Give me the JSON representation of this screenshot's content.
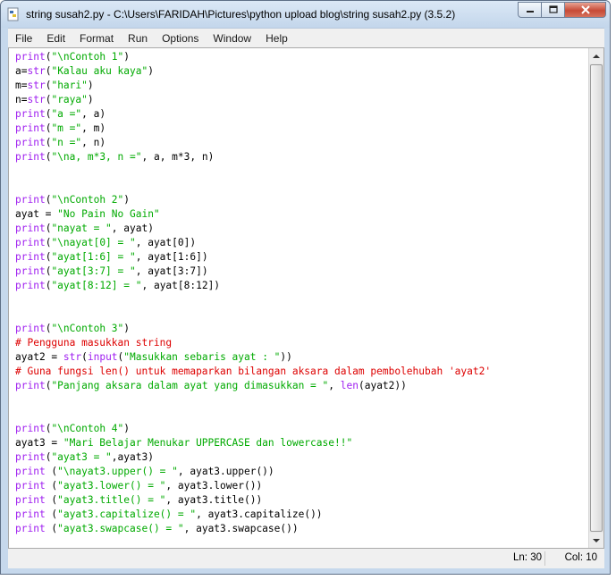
{
  "window": {
    "title": "string susah2.py - C:\\Users\\FARIDAH\\Pictures\\python upload blog\\string susah2.py (3.5.2)"
  },
  "menu": [
    "File",
    "Edit",
    "Format",
    "Run",
    "Options",
    "Window",
    "Help"
  ],
  "code_lines": [
    [
      [
        "kw",
        "print"
      ],
      [
        "",
        "("
      ],
      [
        "str",
        "\"\\nContoh 1\""
      ],
      [
        "",
        ")"
      ]
    ],
    [
      [
        "",
        "a="
      ],
      [
        "kw",
        "str"
      ],
      [
        "",
        "("
      ],
      [
        "str",
        "\"Kalau aku kaya\""
      ],
      [
        "",
        ")"
      ]
    ],
    [
      [
        "",
        "m="
      ],
      [
        "kw",
        "str"
      ],
      [
        "",
        "("
      ],
      [
        "str",
        "\"hari\""
      ],
      [
        "",
        ")"
      ]
    ],
    [
      [
        "",
        "n="
      ],
      [
        "kw",
        "str"
      ],
      [
        "",
        "("
      ],
      [
        "str",
        "\"raya\""
      ],
      [
        "",
        ")"
      ]
    ],
    [
      [
        "kw",
        "print"
      ],
      [
        "",
        "("
      ],
      [
        "str",
        "\"a =\""
      ],
      [
        "",
        ", a)"
      ]
    ],
    [
      [
        "kw",
        "print"
      ],
      [
        "",
        "("
      ],
      [
        "str",
        "\"m =\""
      ],
      [
        "",
        ", m)"
      ]
    ],
    [
      [
        "kw",
        "print"
      ],
      [
        "",
        "("
      ],
      [
        "str",
        "\"n =\""
      ],
      [
        "",
        ", n)"
      ]
    ],
    [
      [
        "kw",
        "print"
      ],
      [
        "",
        "("
      ],
      [
        "str",
        "\"\\na, m*3, n =\""
      ],
      [
        "",
        ", a, m*3, n)"
      ]
    ],
    [],
    [],
    [
      [
        "kw",
        "print"
      ],
      [
        "",
        "("
      ],
      [
        "str",
        "\"\\nContoh 2\""
      ],
      [
        "",
        ")"
      ]
    ],
    [
      [
        "",
        "ayat = "
      ],
      [
        "str",
        "\"No Pain No Gain\""
      ]
    ],
    [
      [
        "kw",
        "print"
      ],
      [
        "",
        "("
      ],
      [
        "str",
        "\"nayat = \""
      ],
      [
        "",
        ", ayat)"
      ]
    ],
    [
      [
        "kw",
        "print"
      ],
      [
        "",
        "("
      ],
      [
        "str",
        "\"\\nayat[0] = \""
      ],
      [
        "",
        ", ayat[0])"
      ]
    ],
    [
      [
        "kw",
        "print"
      ],
      [
        "",
        "("
      ],
      [
        "str",
        "\"ayat[1:6] = \""
      ],
      [
        "",
        ", ayat[1:6])"
      ]
    ],
    [
      [
        "kw",
        "print"
      ],
      [
        "",
        "("
      ],
      [
        "str",
        "\"ayat[3:7] = \""
      ],
      [
        "",
        ", ayat[3:7])"
      ]
    ],
    [
      [
        "kw",
        "print"
      ],
      [
        "",
        "("
      ],
      [
        "str",
        "\"ayat[8:12] = \""
      ],
      [
        "",
        ", ayat[8:12])"
      ]
    ],
    [],
    [],
    [
      [
        "kw",
        "print"
      ],
      [
        "",
        "("
      ],
      [
        "str",
        "\"\\nContoh 3\""
      ],
      [
        "",
        ")"
      ]
    ],
    [
      [
        "cm",
        "# Pengguna masukkan string"
      ]
    ],
    [
      [
        "",
        "ayat2 = "
      ],
      [
        "kw",
        "str"
      ],
      [
        "",
        "("
      ],
      [
        "kw",
        "input"
      ],
      [
        "",
        "("
      ],
      [
        "str",
        "\"Masukkan sebaris ayat : \""
      ],
      [
        "",
        "))"
      ]
    ],
    [
      [
        "cm",
        "# Guna fungsi len() untuk memaparkan bilangan aksara dalam pembolehubah 'ayat2'"
      ]
    ],
    [
      [
        "kw",
        "print"
      ],
      [
        "",
        "("
      ],
      [
        "str",
        "\"Panjang aksara dalam ayat yang dimasukkan = \""
      ],
      [
        "",
        ", "
      ],
      [
        "kw",
        "len"
      ],
      [
        "",
        "(ayat2))"
      ]
    ],
    [],
    [],
    [
      [
        "kw",
        "print"
      ],
      [
        "",
        "("
      ],
      [
        "str",
        "\"\\nContoh 4\""
      ],
      [
        "",
        ")"
      ]
    ],
    [
      [
        "",
        "ayat3 = "
      ],
      [
        "str",
        "\"Mari Belajar Menukar UPPERCASE dan lowercase!!\""
      ]
    ],
    [
      [
        "kw",
        "print"
      ],
      [
        "",
        "("
      ],
      [
        "str",
        "\"ayat3 = \""
      ],
      [
        "",
        ",ayat3)"
      ]
    ],
    [
      [
        "kw",
        "print"
      ],
      [
        "",
        " ("
      ],
      [
        "str",
        "\"\\nayat3.upper() = \""
      ],
      [
        "",
        ", ayat3.upper())"
      ]
    ],
    [
      [
        "kw",
        "print"
      ],
      [
        "",
        " ("
      ],
      [
        "str",
        "\"ayat3.lower() = \""
      ],
      [
        "",
        ", ayat3.lower())"
      ]
    ],
    [
      [
        "kw",
        "print"
      ],
      [
        "",
        " ("
      ],
      [
        "str",
        "\"ayat3.title() = \""
      ],
      [
        "",
        ", ayat3.title())"
      ]
    ],
    [
      [
        "kw",
        "print"
      ],
      [
        "",
        " ("
      ],
      [
        "str",
        "\"ayat3.capitalize() = \""
      ],
      [
        "",
        ", ayat3.capitalize())"
      ]
    ],
    [
      [
        "kw",
        "print"
      ],
      [
        "",
        " ("
      ],
      [
        "str",
        "\"ayat3.swapcase() = \""
      ],
      [
        "",
        ", ayat3.swapcase())"
      ]
    ]
  ],
  "status": {
    "line": "Ln: 30",
    "col": "Col: 10"
  },
  "colors": {
    "keyword": "#a020f0",
    "string": "#00aa00",
    "comment": "#dd0000",
    "close_button": "#c74a36"
  }
}
